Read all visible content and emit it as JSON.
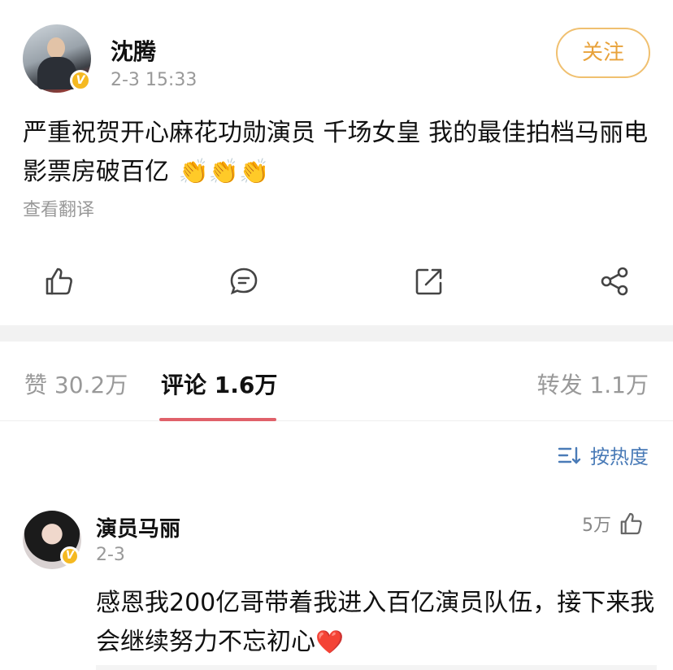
{
  "post": {
    "username": "沈腾",
    "time": "2-3 15:33",
    "verified_mark": "V",
    "follow_label": "关注",
    "text": "严重祝贺开心麻花功勋演员 千场女皇 我的最佳拍档马丽电影票房破百亿",
    "emoji": "👏👏👏",
    "translate_label": "查看翻译",
    "action_icons": [
      "like-icon",
      "comment-icon",
      "repost-icon",
      "share-icon"
    ]
  },
  "tabs": {
    "likes": "赞 30.2万",
    "comments": "评论 1.6万",
    "reposts": "转发 1.1万",
    "active": "comments"
  },
  "sort": {
    "label": "按热度"
  },
  "comment": {
    "username": "演员马丽",
    "time": "2-3",
    "verified_mark": "V",
    "like_count": "5万",
    "text": "感恩我200亿哥带着我进入百亿演员队伍，接下来我会继续努力不忘初心",
    "heart": "❤️"
  },
  "colors": {
    "follow_border": "#f0c070",
    "follow_text": "#e8a23a",
    "tab_underline": "#e0616a",
    "sort_link": "#4a7bb7",
    "verified_badge": "#f5b921"
  }
}
